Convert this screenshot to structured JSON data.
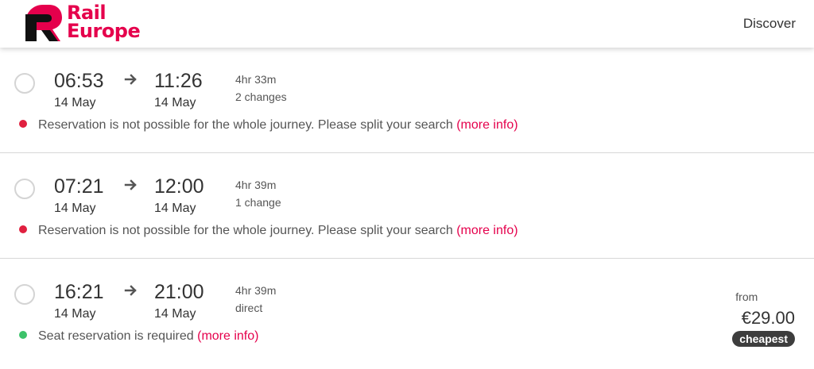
{
  "header": {
    "logo_line1": "Rail",
    "logo_line2": "Europe",
    "nav_discover": "Discover"
  },
  "colors": {
    "brand": "#e5004c",
    "status_red": "#e0203f",
    "status_green": "#3cc26a",
    "badge": "#3d3d3d"
  },
  "icons": {
    "logo": "rail-europe-logo-icon",
    "arrow": "arrow-right-icon",
    "radio": "radio-unselected-icon"
  },
  "journeys": [
    {
      "departure_time": "06:53",
      "departure_date": "14 May",
      "arrival_time": "11:26",
      "arrival_date": "14 May",
      "duration": "4hr 33m",
      "changes": "2 changes",
      "notice_status": "red",
      "notice_text": "Reservation is not possible for the whole journey. Please split your search",
      "more_info": "(more info)"
    },
    {
      "departure_time": "07:21",
      "departure_date": "14 May",
      "arrival_time": "12:00",
      "arrival_date": "14 May",
      "duration": "4hr 39m",
      "changes": "1 change",
      "notice_status": "red",
      "notice_text": "Reservation is not possible for the whole journey. Please split your search",
      "more_info": "(more info)"
    },
    {
      "departure_time": "16:21",
      "departure_date": "14 May",
      "arrival_time": "21:00",
      "arrival_date": "14 May",
      "duration": "4hr 39m",
      "changes": "direct",
      "notice_status": "green",
      "notice_text": "Seat reservation is required",
      "more_info": "(more info)",
      "price_from": "from",
      "price": "€29.00",
      "price_badge": "cheapest"
    }
  ]
}
